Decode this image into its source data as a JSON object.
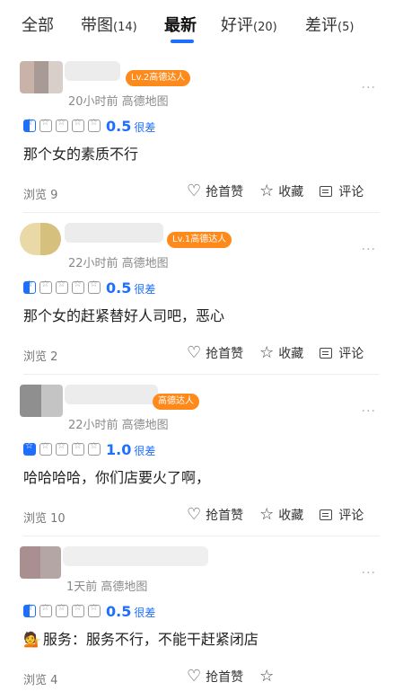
{
  "tabs": [
    {
      "label": "全部",
      "count": ""
    },
    {
      "label": "带图",
      "count": "(14)"
    },
    {
      "label": "最新",
      "count": ""
    },
    {
      "label": "好评",
      "count": "(20)"
    },
    {
      "label": "差评",
      "count": "(5)"
    }
  ],
  "active_tab": "最新",
  "colors": {
    "accent": "#1f6fff",
    "badge": "#ff8a1c"
  },
  "reviews": [
    {
      "badge": "Lv.2高德达人",
      "time": "20小时前  高德地图",
      "score": "0.5",
      "score_word": "很差",
      "rating": 0.5,
      "content": "那个女的素质不行",
      "views": "浏览 9",
      "like": "抢首赞",
      "fav": "收藏",
      "comment": "评论",
      "more": "..."
    },
    {
      "badge": "Lv.1高德达人",
      "time": "22小时前  高德地图",
      "score": "0.5",
      "score_word": "很差",
      "rating": 0.5,
      "content": "那个女的赶紧替好人司吧，恶心",
      "views": "浏览 2",
      "like": "抢首赞",
      "fav": "收藏",
      "comment": "评论",
      "more": "..."
    },
    {
      "badge": "高德达人",
      "time": "22小时前  高德地图",
      "score": "1.0",
      "score_word": "很差",
      "rating": 1.0,
      "content": "哈哈哈哈，你们店要火了啊，",
      "views": "浏览 10",
      "like": "抢首赞",
      "fav": "收藏",
      "comment": "评论",
      "more": "..."
    },
    {
      "badge": "",
      "time": "1天前  高德地图",
      "score": "0.5",
      "score_word": "很差",
      "rating": 0.5,
      "content": "服务：服务不行，不能干赶紧闭店",
      "content_icon": "person-icon",
      "views": "浏览 4",
      "like": "抢首赞",
      "fav": "",
      "comment": "",
      "more": "..."
    }
  ]
}
